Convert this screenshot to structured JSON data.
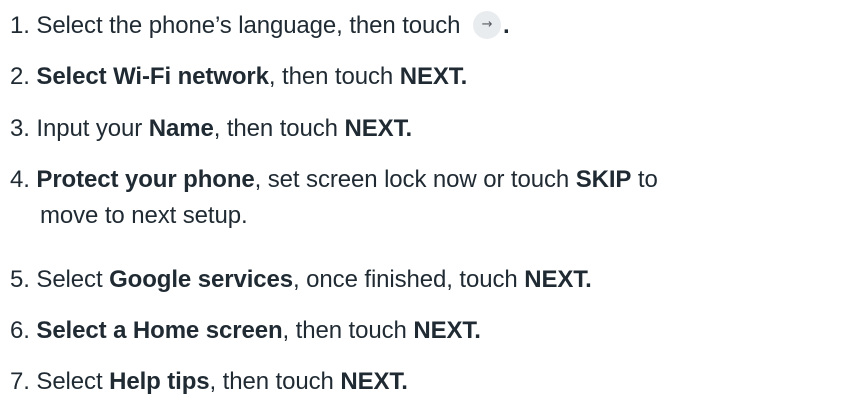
{
  "steps": [
    {
      "num": "1.",
      "t1": "Select the phone’s language,  then touch",
      "icon": "→",
      "t2": "."
    },
    {
      "num": "2.",
      "b1": "Select Wi-Fi network",
      "t1": ", then touch",
      "b2": "NEXT."
    },
    {
      "num": "3.",
      "t1": "Input your",
      "b1": "Name",
      "t2": ", then touch",
      "b2": "NEXT."
    },
    {
      "num": "4.",
      "b1": "Protect your phone",
      "t1": ", set screen lock now or touch",
      "b2": "SKIP",
      "t2": "to",
      "t3": "move to next setup."
    },
    {
      "num": "5.",
      "t1": "Select",
      "b1": "Google services",
      "t2": ", once finished, touch",
      "b2": "NEXT."
    },
    {
      "num": "6.",
      "b1": "Select a Home screen",
      "t1": ", then touch",
      "b2": "NEXT."
    },
    {
      "num": "7.",
      "t1": "Select",
      "b1": "Help tips",
      "t2": ", then touch",
      "b2": "NEXT."
    }
  ],
  "icons": {
    "next_arrow": "arrow-right-icon"
  }
}
